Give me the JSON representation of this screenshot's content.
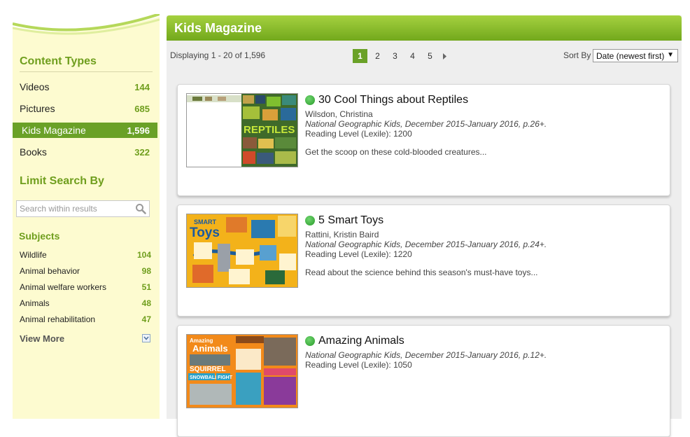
{
  "sidebar": {
    "content_types_title": "Content Types",
    "content_types": [
      {
        "label": "Videos",
        "count": "144"
      },
      {
        "label": "Pictures",
        "count": "685"
      },
      {
        "label": "Kids Magazine",
        "count": "1,596"
      },
      {
        "label": "Books",
        "count": "322"
      }
    ],
    "limit_title": "Limit Search By",
    "search_placeholder": "Search within results",
    "subjects_title": "Subjects",
    "subjects": [
      {
        "label": "Wildlife",
        "count": "104"
      },
      {
        "label": "Animal behavior",
        "count": "98"
      },
      {
        "label": "Animal welfare workers",
        "count": "51"
      },
      {
        "label": "Animals",
        "count": "48"
      },
      {
        "label": "Animal rehabilitation",
        "count": "47"
      }
    ],
    "view_more": "View More"
  },
  "main": {
    "title": "Kids Magazine",
    "displaying": "Displaying 1 - 20 of 1,596",
    "pages": [
      "1",
      "2",
      "3",
      "4",
      "5"
    ],
    "sort_label": "Sort By",
    "sort_value": "Date (newest first)",
    "results": [
      {
        "title": "30 Cool Things about Reptiles",
        "author": "Wilsdon, Christina",
        "source": "National Geographic Kids, December 2015-January 2016, p.26+.",
        "reading_level": "Reading Level (Lexile): 1200",
        "description": "Get the scoop on these cold-blooded creatures..."
      },
      {
        "title": "5 Smart Toys",
        "author": "Rattini, Kristin Baird",
        "source": "National Geographic Kids, December 2015-January 2016, p.24+.",
        "reading_level": "Reading Level (Lexile): 1220",
        "description": "Read about the science behind this season's must-have toys..."
      },
      {
        "title": "Amazing Animals",
        "source": "National Geographic Kids, December 2015-January 2016, p.12+.",
        "reading_level": "Reading Level (Lexile): 1050"
      }
    ],
    "thumb_texts": {
      "reptiles": "REPTILES",
      "toys_smart": "SMART",
      "toys": "Toys",
      "amazing": "Amazing",
      "animals": "Animals",
      "squirrel": "SQUIRREL",
      "snowball": "SNOWBALL",
      "fight": "FIGHT"
    }
  },
  "colors": {
    "accent_green": "#6aa127",
    "sidebar_bg": "#fdfbd0",
    "header_green": "#8cc12b",
    "status_dot": "#2a9b2a"
  }
}
